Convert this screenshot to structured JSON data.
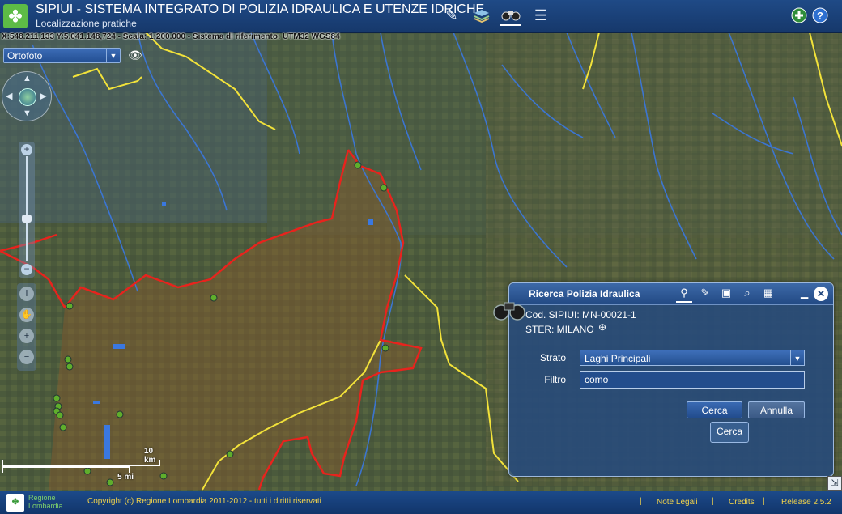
{
  "header": {
    "title": "SIPIUI - SISTEMA INTEGRATO DI POLIZIA IDRAULICA E UTENZE IDRICHE",
    "subtitle": "Localizzazione pratiche",
    "tools": [
      {
        "icon": "pencil-icon"
      },
      {
        "icon": "layers-icon"
      },
      {
        "icon": "binoculars-icon"
      },
      {
        "icon": "list-icon"
      }
    ],
    "right_icons": [
      "add-icon",
      "help-icon"
    ]
  },
  "coords": "X:548.211,133 Y:5.041.148,724 - Scala: 1:200.000 - Sistema di riferimento: UTM32 WGS84",
  "basemap": {
    "selected": "Ortofoto"
  },
  "scale": {
    "km": "10 km",
    "mi": "5 mi"
  },
  "dialog": {
    "title": "Ricerca Polizia Idraulica",
    "code_line": "Cod. SIPIUI: MN-00021-1",
    "ster_line": "STER: MILANO",
    "strato_label": "Strato",
    "strato_value": "Laghi Principali",
    "filtro_label": "Filtro",
    "filtro_value": "como",
    "search_button": "Cerca",
    "cancel_button": "Annulla",
    "tooltip": "Cerca"
  },
  "footer": {
    "region_line1": "Regione",
    "region_line2": "Lombardia",
    "copyright": "Copyright (c) Regione Lombardia 2011-2012 - tutti i diritti riservati",
    "note_legali": "Note Legali",
    "credits": "Credits",
    "release": "Release 2.5.2"
  },
  "colors": {
    "header_bg": "#1f4a86",
    "boundary_red": "#e8231d",
    "boundary_yellow": "#f2e23a",
    "rivers_blue": "#3a78e0",
    "markers_green": "#5fae2c"
  }
}
